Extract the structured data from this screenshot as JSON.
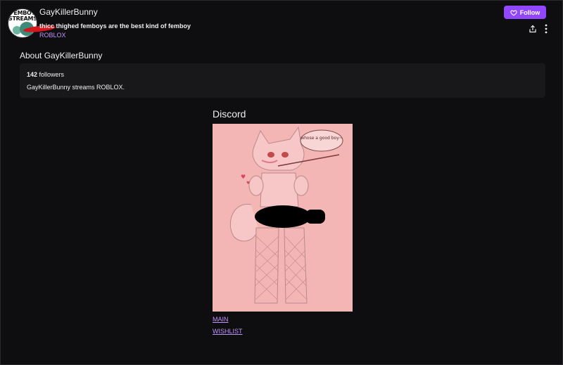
{
  "header": {
    "avatar_text": "FEMBOY STREAMS",
    "channel_name": "GayKillerBunny",
    "stream_title": "thicc thighed femboys are the best kind of femboy",
    "category": "ROBLOX",
    "follow_label": "Follow",
    "icons": [
      "heart-icon",
      "share-icon",
      "more-options-icon"
    ],
    "accent_color": "#9147ff",
    "link_color": "#bf94ff"
  },
  "about": {
    "heading": "About GayKillerBunny",
    "followers_count": "142",
    "followers_label": "followers",
    "description": "GayKillerBunny streams ROBLOX."
  },
  "panel": {
    "title": "Discord",
    "image_text": "whose a good boy~",
    "links": [
      "MAIN",
      "WISHLIST"
    ]
  }
}
